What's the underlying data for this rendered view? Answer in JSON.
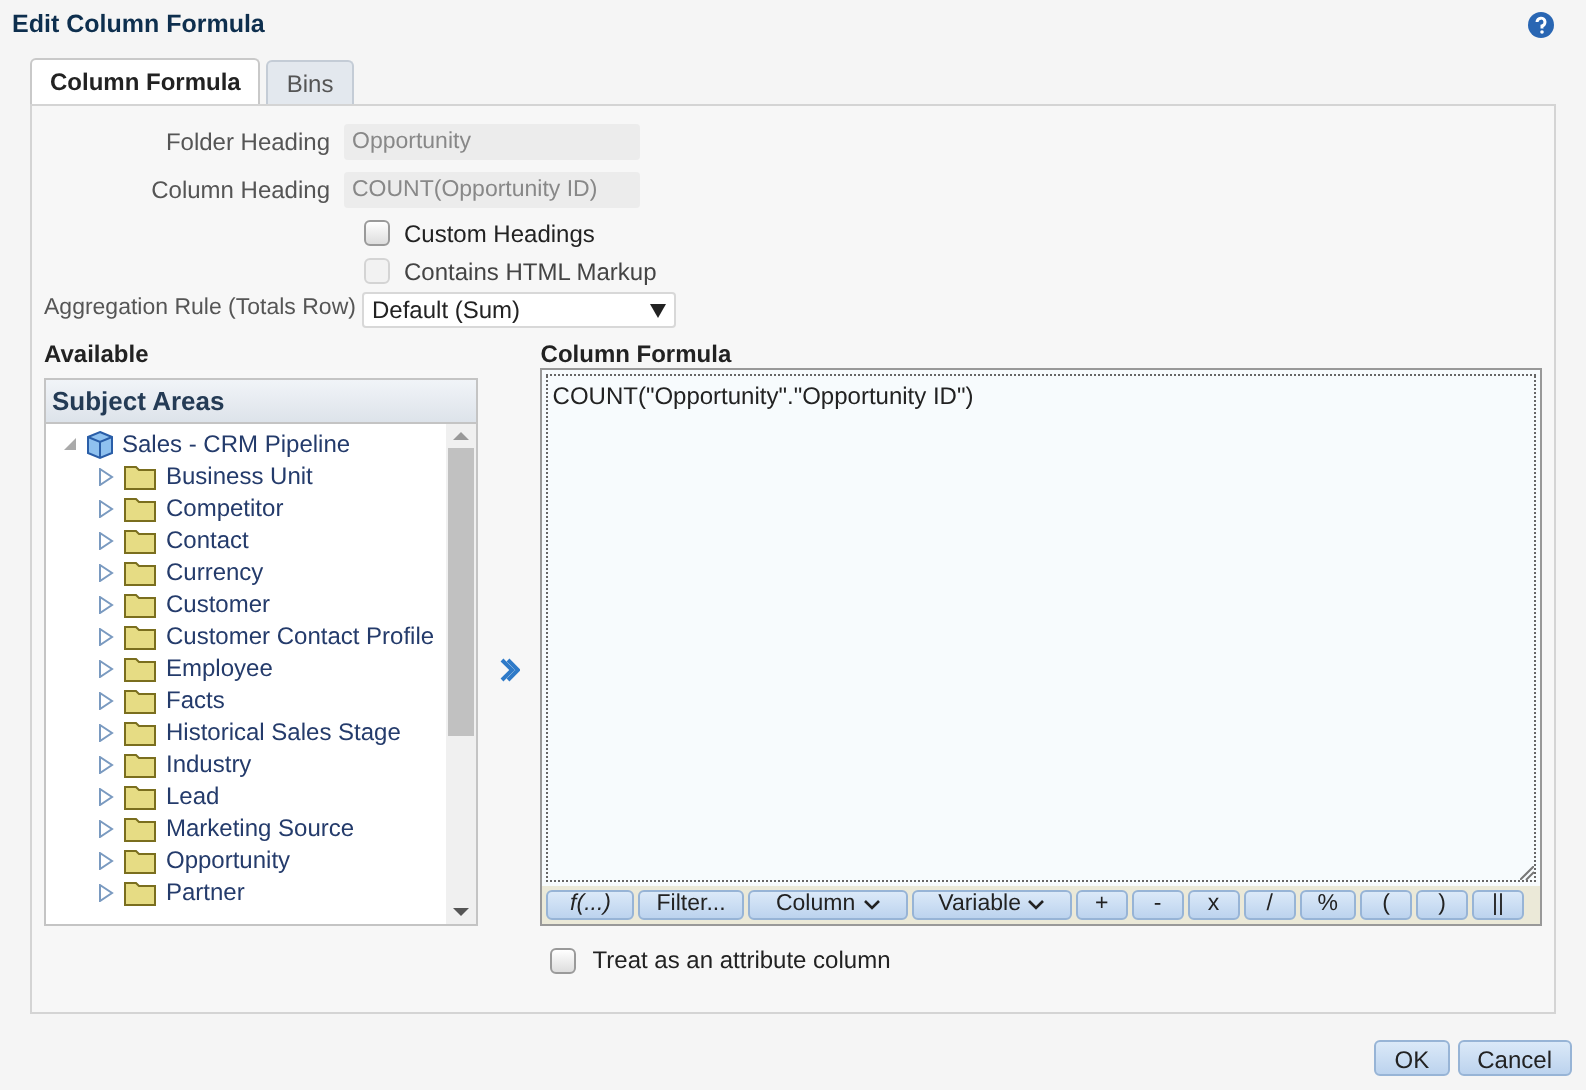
{
  "window": {
    "title": "Edit Column Formula"
  },
  "tabs": [
    {
      "label": "Column Formula",
      "selected": true
    },
    {
      "label": "Bins",
      "selected": false
    }
  ],
  "fields": [
    {
      "label": "Folder Heading",
      "value": "Opportunity"
    },
    {
      "label": "Column Heading",
      "value": "COUNT(Opportunity ID)"
    }
  ],
  "options": [
    {
      "label": "Custom Headings",
      "checked": false,
      "disabled": false
    },
    {
      "label": "Contains HTML Markup",
      "checked": false,
      "disabled": true
    }
  ],
  "aggregation": {
    "label": "Aggregation Rule (Totals Row)",
    "value": "Default (Sum)"
  },
  "available": {
    "heading": "Available",
    "panel_title": "Subject Areas",
    "tree": [
      {
        "label": "Sales - CRM Pipeline",
        "expanded": true,
        "children": [
          {
            "label": "Business Unit",
            "expanded": false
          },
          {
            "label": "Competitor",
            "expanded": false
          },
          {
            "label": "Contact",
            "expanded": false
          },
          {
            "label": "Currency",
            "expanded": false
          },
          {
            "label": "Customer",
            "expanded": false
          },
          {
            "label": "Customer Contact Profile",
            "expanded": false
          },
          {
            "label": "Employee",
            "expanded": false
          },
          {
            "label": "Facts",
            "expanded": false
          },
          {
            "label": "Historical Sales Stage",
            "expanded": false
          },
          {
            "label": "Industry",
            "expanded": false
          },
          {
            "label": "Lead",
            "expanded": false
          },
          {
            "label": "Marketing Source",
            "expanded": false
          },
          {
            "label": "Opportunity",
            "expanded": false
          },
          {
            "label": "Partner",
            "expanded": false
          }
        ]
      }
    ]
  },
  "formula": {
    "heading": "Column Formula",
    "value": "COUNT(\"Opportunity\".\"Opportunity ID\")",
    "buttons": [
      {
        "label": "f(...)",
        "italic": true,
        "menu": false
      },
      {
        "label": "Filter...",
        "italic": false,
        "menu": false
      },
      {
        "label": "Column",
        "italic": false,
        "menu": true
      },
      {
        "label": "Variable",
        "italic": false,
        "menu": true
      },
      {
        "label": "+",
        "italic": false,
        "menu": false
      },
      {
        "label": "-",
        "italic": false,
        "menu": false
      },
      {
        "label": "x",
        "italic": false,
        "menu": false
      },
      {
        "label": "/",
        "italic": false,
        "menu": false
      },
      {
        "label": "%",
        "italic": false,
        "menu": false
      },
      {
        "label": "(",
        "italic": false,
        "menu": false
      },
      {
        "label": ")",
        "italic": false,
        "menu": false
      },
      {
        "label": "||",
        "italic": false,
        "menu": false
      }
    ]
  },
  "attribute_option": {
    "label": "Treat as an attribute column",
    "checked": false
  },
  "buttons": [
    "OK",
    "Cancel"
  ]
}
